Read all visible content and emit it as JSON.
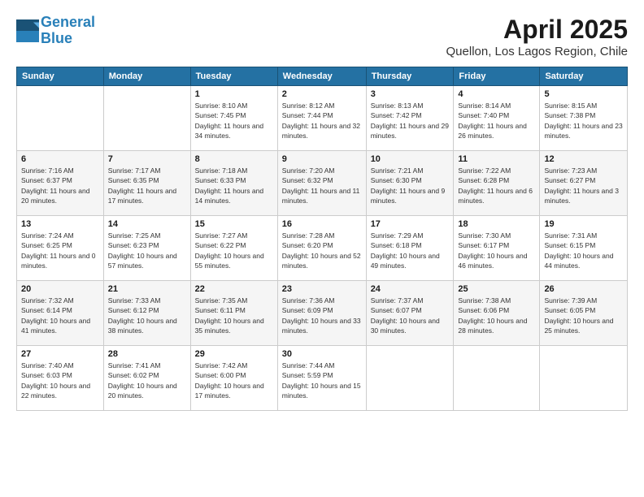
{
  "header": {
    "logo_line1": "General",
    "logo_line2": "Blue",
    "month_title": "April 2025",
    "subtitle": "Quellon, Los Lagos Region, Chile"
  },
  "weekdays": [
    "Sunday",
    "Monday",
    "Tuesday",
    "Wednesday",
    "Thursday",
    "Friday",
    "Saturday"
  ],
  "weeks": [
    [
      {
        "day": "",
        "info": ""
      },
      {
        "day": "",
        "info": ""
      },
      {
        "day": "1",
        "info": "Sunrise: 8:10 AM\nSunset: 7:45 PM\nDaylight: 11 hours and 34 minutes."
      },
      {
        "day": "2",
        "info": "Sunrise: 8:12 AM\nSunset: 7:44 PM\nDaylight: 11 hours and 32 minutes."
      },
      {
        "day": "3",
        "info": "Sunrise: 8:13 AM\nSunset: 7:42 PM\nDaylight: 11 hours and 29 minutes."
      },
      {
        "day": "4",
        "info": "Sunrise: 8:14 AM\nSunset: 7:40 PM\nDaylight: 11 hours and 26 minutes."
      },
      {
        "day": "5",
        "info": "Sunrise: 8:15 AM\nSunset: 7:38 PM\nDaylight: 11 hours and 23 minutes."
      }
    ],
    [
      {
        "day": "6",
        "info": "Sunrise: 7:16 AM\nSunset: 6:37 PM\nDaylight: 11 hours and 20 minutes."
      },
      {
        "day": "7",
        "info": "Sunrise: 7:17 AM\nSunset: 6:35 PM\nDaylight: 11 hours and 17 minutes."
      },
      {
        "day": "8",
        "info": "Sunrise: 7:18 AM\nSunset: 6:33 PM\nDaylight: 11 hours and 14 minutes."
      },
      {
        "day": "9",
        "info": "Sunrise: 7:20 AM\nSunset: 6:32 PM\nDaylight: 11 hours and 11 minutes."
      },
      {
        "day": "10",
        "info": "Sunrise: 7:21 AM\nSunset: 6:30 PM\nDaylight: 11 hours and 9 minutes."
      },
      {
        "day": "11",
        "info": "Sunrise: 7:22 AM\nSunset: 6:28 PM\nDaylight: 11 hours and 6 minutes."
      },
      {
        "day": "12",
        "info": "Sunrise: 7:23 AM\nSunset: 6:27 PM\nDaylight: 11 hours and 3 minutes."
      }
    ],
    [
      {
        "day": "13",
        "info": "Sunrise: 7:24 AM\nSunset: 6:25 PM\nDaylight: 11 hours and 0 minutes."
      },
      {
        "day": "14",
        "info": "Sunrise: 7:25 AM\nSunset: 6:23 PM\nDaylight: 10 hours and 57 minutes."
      },
      {
        "day": "15",
        "info": "Sunrise: 7:27 AM\nSunset: 6:22 PM\nDaylight: 10 hours and 55 minutes."
      },
      {
        "day": "16",
        "info": "Sunrise: 7:28 AM\nSunset: 6:20 PM\nDaylight: 10 hours and 52 minutes."
      },
      {
        "day": "17",
        "info": "Sunrise: 7:29 AM\nSunset: 6:18 PM\nDaylight: 10 hours and 49 minutes."
      },
      {
        "day": "18",
        "info": "Sunrise: 7:30 AM\nSunset: 6:17 PM\nDaylight: 10 hours and 46 minutes."
      },
      {
        "day": "19",
        "info": "Sunrise: 7:31 AM\nSunset: 6:15 PM\nDaylight: 10 hours and 44 minutes."
      }
    ],
    [
      {
        "day": "20",
        "info": "Sunrise: 7:32 AM\nSunset: 6:14 PM\nDaylight: 10 hours and 41 minutes."
      },
      {
        "day": "21",
        "info": "Sunrise: 7:33 AM\nSunset: 6:12 PM\nDaylight: 10 hours and 38 minutes."
      },
      {
        "day": "22",
        "info": "Sunrise: 7:35 AM\nSunset: 6:11 PM\nDaylight: 10 hours and 35 minutes."
      },
      {
        "day": "23",
        "info": "Sunrise: 7:36 AM\nSunset: 6:09 PM\nDaylight: 10 hours and 33 minutes."
      },
      {
        "day": "24",
        "info": "Sunrise: 7:37 AM\nSunset: 6:07 PM\nDaylight: 10 hours and 30 minutes."
      },
      {
        "day": "25",
        "info": "Sunrise: 7:38 AM\nSunset: 6:06 PM\nDaylight: 10 hours and 28 minutes."
      },
      {
        "day": "26",
        "info": "Sunrise: 7:39 AM\nSunset: 6:05 PM\nDaylight: 10 hours and 25 minutes."
      }
    ],
    [
      {
        "day": "27",
        "info": "Sunrise: 7:40 AM\nSunset: 6:03 PM\nDaylight: 10 hours and 22 minutes."
      },
      {
        "day": "28",
        "info": "Sunrise: 7:41 AM\nSunset: 6:02 PM\nDaylight: 10 hours and 20 minutes."
      },
      {
        "day": "29",
        "info": "Sunrise: 7:42 AM\nSunset: 6:00 PM\nDaylight: 10 hours and 17 minutes."
      },
      {
        "day": "30",
        "info": "Sunrise: 7:44 AM\nSunset: 5:59 PM\nDaylight: 10 hours and 15 minutes."
      },
      {
        "day": "",
        "info": ""
      },
      {
        "day": "",
        "info": ""
      },
      {
        "day": "",
        "info": ""
      }
    ]
  ]
}
